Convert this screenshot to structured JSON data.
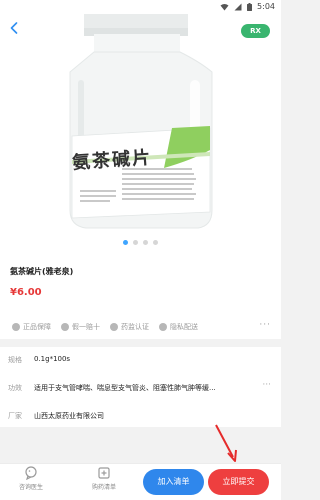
{
  "status_bar": {
    "time": "5:04"
  },
  "header": {
    "rx_badge": "RX"
  },
  "product_image": {
    "label_text": "氨茶碱片"
  },
  "carousel": {
    "total": 4,
    "active": 1
  },
  "product": {
    "name": "氨茶碱片(雅老泉)",
    "price": "¥6.00",
    "tags": [
      "正品保障",
      "假一赔十",
      "药监认证",
      "隐私配送"
    ]
  },
  "specs": [
    {
      "label": "规格",
      "value": "0.1g*100s"
    },
    {
      "label": "功效",
      "value": "适用于支气管哮喘、喘息型支气管炎、阻塞性肺气肿等缓..."
    },
    {
      "label": "厂家",
      "value": "山西太原药业有限公司"
    }
  ],
  "bottom_bar": {
    "tab_consult": "咨询医生",
    "tab_cart": "购药清单",
    "add_button": "加入清单",
    "submit_button": "立即提交"
  },
  "colors": {
    "rx_green": "#39b56f",
    "price_red": "#e63737",
    "add_blue": "#2f87ec",
    "submit_red": "#ee3f3f",
    "back_blue": "#2f8ff2"
  }
}
